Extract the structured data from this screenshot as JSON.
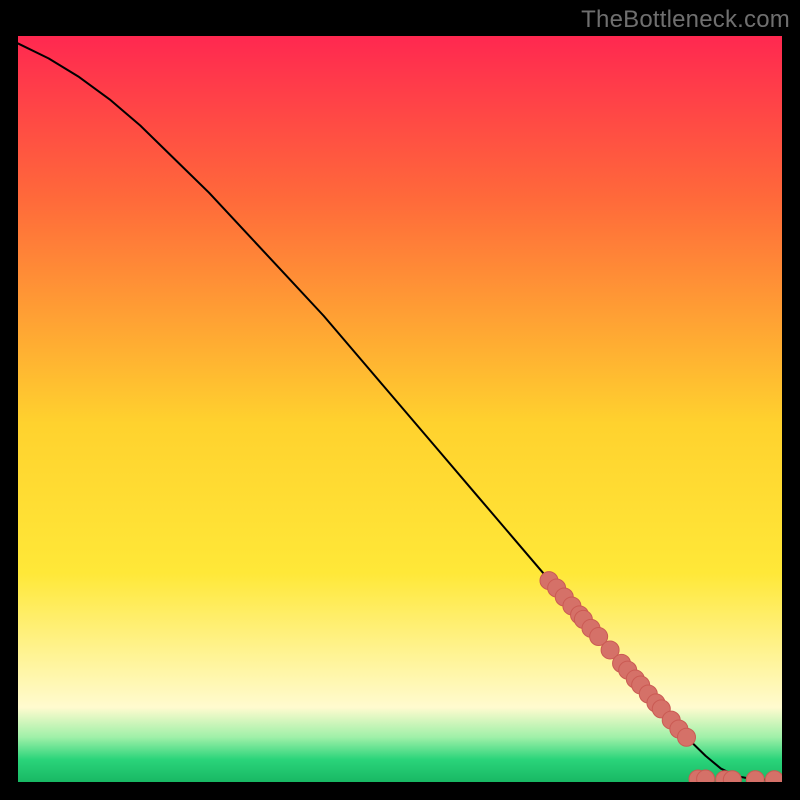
{
  "watermark": "TheBottleneck.com",
  "colors": {
    "frame": "#000000",
    "grad_top": "#ff2850",
    "grad_mid_upper": "#ff6a3a",
    "grad_mid": "#ffd22e",
    "grad_mid_lower": "#ffe838",
    "grad_pale": "#fffbcf",
    "grad_green_light": "#9ff0a8",
    "grad_green": "#2ad47a",
    "grad_green_dark": "#18b864",
    "line": "#000000",
    "dot_fill": "#d57168",
    "dot_stroke": "#ca5a53"
  },
  "chart_data": {
    "type": "line",
    "title": "",
    "xlabel": "",
    "ylabel": "",
    "xlim": [
      0,
      100
    ],
    "ylim": [
      0,
      100
    ],
    "series": [
      {
        "name": "bottleneck-curve",
        "x": [
          0,
          4,
          8,
          12,
          16,
          20,
          25,
          30,
          35,
          40,
          45,
          50,
          55,
          60,
          65,
          70,
          73,
          76,
          79,
          82,
          85,
          87.5,
          90,
          92,
          94,
          96,
          98,
          100
        ],
        "y": [
          99,
          97,
          94.5,
          91.5,
          88,
          84,
          79,
          73.5,
          68,
          62.5,
          56.5,
          50.5,
          44.5,
          38.5,
          32.5,
          26.5,
          23,
          19.5,
          16,
          12.5,
          9,
          6,
          3.5,
          1.8,
          0.8,
          0.4,
          0.3,
          0.3
        ]
      }
    ],
    "markers": {
      "name": "data-points",
      "points": [
        {
          "x": 69.5,
          "y": 27.0
        },
        {
          "x": 70.5,
          "y": 26.0
        },
        {
          "x": 71.5,
          "y": 24.8
        },
        {
          "x": 72.5,
          "y": 23.6
        },
        {
          "x": 73.5,
          "y": 22.4
        },
        {
          "x": 74.0,
          "y": 21.8
        },
        {
          "x": 75.0,
          "y": 20.6
        },
        {
          "x": 76.0,
          "y": 19.5
        },
        {
          "x": 77.5,
          "y": 17.7
        },
        {
          "x": 79.0,
          "y": 15.9
        },
        {
          "x": 79.8,
          "y": 15.0
        },
        {
          "x": 80.8,
          "y": 13.8
        },
        {
          "x": 81.5,
          "y": 13.0
        },
        {
          "x": 82.5,
          "y": 11.8
        },
        {
          "x": 83.5,
          "y": 10.6
        },
        {
          "x": 84.2,
          "y": 9.8
        },
        {
          "x": 85.5,
          "y": 8.3
        },
        {
          "x": 86.5,
          "y": 7.1
        },
        {
          "x": 87.5,
          "y": 6.0
        },
        {
          "x": 89.0,
          "y": 0.4
        },
        {
          "x": 90.0,
          "y": 0.4
        },
        {
          "x": 92.5,
          "y": 0.3
        },
        {
          "x": 93.5,
          "y": 0.3
        },
        {
          "x": 96.5,
          "y": 0.3
        },
        {
          "x": 99.0,
          "y": 0.3
        }
      ]
    }
  }
}
